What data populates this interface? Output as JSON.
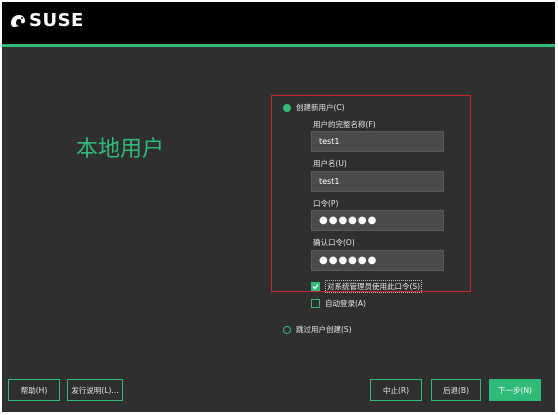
{
  "header": {
    "brand": "SUSE"
  },
  "page": {
    "title": "本地用户"
  },
  "form": {
    "create_user_label": "创建新用户(C)",
    "full_name_label": "用户的完整名称(F)",
    "full_name_value": "test1",
    "username_label": "用户名(U)",
    "username_value": "test1",
    "password_label": "口令(P)",
    "password_value": "●●●●●●",
    "confirm_password_label": "确认口令(O)",
    "confirm_password_value": "●●●●●●",
    "use_for_admin_label": "对系统管理员使用此口令(S)",
    "use_for_admin_checked": true,
    "auto_login_label": "自动登录(A)",
    "auto_login_checked": false,
    "skip_user_label": "跳过用户创建(S)"
  },
  "buttons": {
    "help": "帮助(H)",
    "release_notes": "发行说明(L)...",
    "abort": "中止(R)",
    "back": "后退(B)",
    "next": "下一步(N)"
  },
  "colors": {
    "accent": "#30ba78",
    "background": "#2f2f2f",
    "highlight_box": "#c8262b"
  }
}
